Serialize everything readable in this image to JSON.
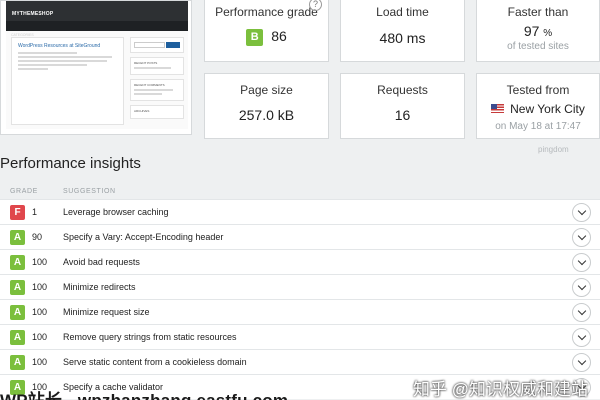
{
  "thumbnail": {
    "site_name": "MYTHEMESHOP",
    "nav_text": "CATEGORIES",
    "post_title": "WordPress Resources at SiteGround",
    "sidebar_boxes": [
      "RECENT POSTS",
      "RECENT COMMENTS",
      "ARCHIVES"
    ]
  },
  "summary": {
    "performance_grade": {
      "label": "Performance grade",
      "grade": "B",
      "value": "86",
      "grade_color": "#7bbf3d"
    },
    "load_time": {
      "label": "Load time",
      "value": "480 ms"
    },
    "faster_than": {
      "label": "Faster than",
      "value": "97",
      "unit": "%",
      "sub": "of tested sites"
    },
    "page_size": {
      "label": "Page size",
      "value": "257.0 kB"
    },
    "requests": {
      "label": "Requests",
      "value": "16"
    },
    "tested_from": {
      "label": "Tested from",
      "location": "New York City",
      "date": "on May 18 at 17:47"
    },
    "brand": "pingdom"
  },
  "insights": {
    "title": "Performance insights",
    "columns": {
      "grade": "GRADE",
      "suggestion": "SUGGESTION"
    },
    "rows": [
      {
        "grade": "F",
        "color": "#e0474c",
        "score": "1",
        "suggestion": "Leverage browser caching"
      },
      {
        "grade": "A",
        "color": "#7bbf3d",
        "score": "90",
        "suggestion": "Specify a Vary: Accept-Encoding header"
      },
      {
        "grade": "A",
        "color": "#7bbf3d",
        "score": "100",
        "suggestion": "Avoid bad requests"
      },
      {
        "grade": "A",
        "color": "#7bbf3d",
        "score": "100",
        "suggestion": "Minimize redirects"
      },
      {
        "grade": "A",
        "color": "#7bbf3d",
        "score": "100",
        "suggestion": "Minimize request size"
      },
      {
        "grade": "A",
        "color": "#7bbf3d",
        "score": "100",
        "suggestion": "Remove query strings from static resources"
      },
      {
        "grade": "A",
        "color": "#7bbf3d",
        "score": "100",
        "suggestion": "Serve static content from a cookieless domain"
      },
      {
        "grade": "A",
        "color": "#7bbf3d",
        "score": "100",
        "suggestion": "Specify a cache validator"
      }
    ]
  },
  "watermarks": {
    "left": "WP站长 - wpzhanzhang.eastfu.com",
    "right": "知乎 @知识权威和建站"
  }
}
